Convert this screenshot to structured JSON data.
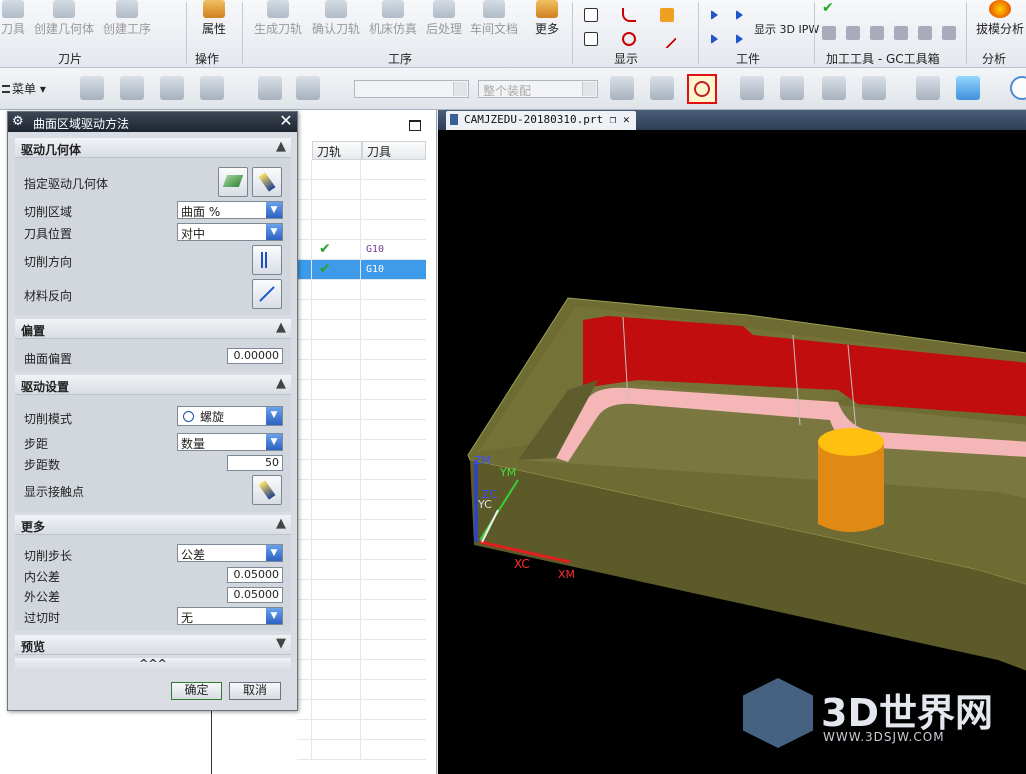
{
  "ribbon": {
    "buttons": [
      "刀具",
      "创建几何体",
      "创建工序",
      "属性",
      "生成刀轨",
      "确认刀轨",
      "机床仿真",
      "后处理",
      "车间文档",
      "更多",
      "显示 3D IPW",
      "拔模分析"
    ],
    "groups": [
      "刀片",
      "操作",
      "工序",
      "显示",
      "工件",
      "加工工具 - GC工具箱",
      "分析"
    ]
  },
  "toolbar": {
    "menu_label": "菜单",
    "filter_placeholder": "",
    "scope_value": "整个装配"
  },
  "navigator": {
    "columns": [
      "刀轨",
      "刀具"
    ],
    "rows": [
      {
        "toolpath_ok": true,
        "tool": "G10",
        "selected": false
      },
      {
        "toolpath_ok": true,
        "tool": "G10",
        "selected": true
      }
    ]
  },
  "viewport": {
    "tab_label": "CAMJZEDU-20180310.prt",
    "axes": {
      "zm": "ZM",
      "ym": "YM",
      "zc": "ZC",
      "yc": "YC",
      "xc": "XC",
      "xm": "XM"
    }
  },
  "dialog": {
    "title": "曲面区域驱动方法",
    "sections": {
      "drive_geometry": {
        "header": "驱动几何体",
        "specify_label": "指定驱动几何体",
        "cut_area_label": "切削区域",
        "cut_area_value": "曲面 %",
        "tool_position_label": "刀具位置",
        "tool_position_value": "对中",
        "cut_direction_label": "切削方向",
        "material_reverse_label": "材料反向"
      },
      "offset": {
        "header": "偏置",
        "surface_offset_label": "曲面偏置",
        "surface_offset_value": "0.00000"
      },
      "drive_settings": {
        "header": "驱动设置",
        "cut_mode_label": "切削模式",
        "cut_mode_value": "螺旋",
        "stepover_label": "步距",
        "stepover_value": "数量",
        "stepover_count_label": "步距数",
        "stepover_count_value": "50",
        "show_contact_label": "显示接触点"
      },
      "more": {
        "header": "更多",
        "cut_step_label": "切削步长",
        "cut_step_value": "公差",
        "intol_label": "内公差",
        "intol_value": "0.05000",
        "outtol_label": "外公差",
        "outtol_value": "0.05000",
        "overcut_label": "过切时",
        "overcut_value": "无"
      },
      "preview": {
        "header": "预览"
      }
    },
    "ok_label": "确定",
    "cancel_label": "取消"
  },
  "watermark": {
    "brand": "3D世界网",
    "url": "WWW.3DSJW.COM"
  },
  "colors": {
    "part": "#7c7a3c",
    "wall": "#cc1010",
    "tool": "#f0a010",
    "background": "#000000"
  }
}
